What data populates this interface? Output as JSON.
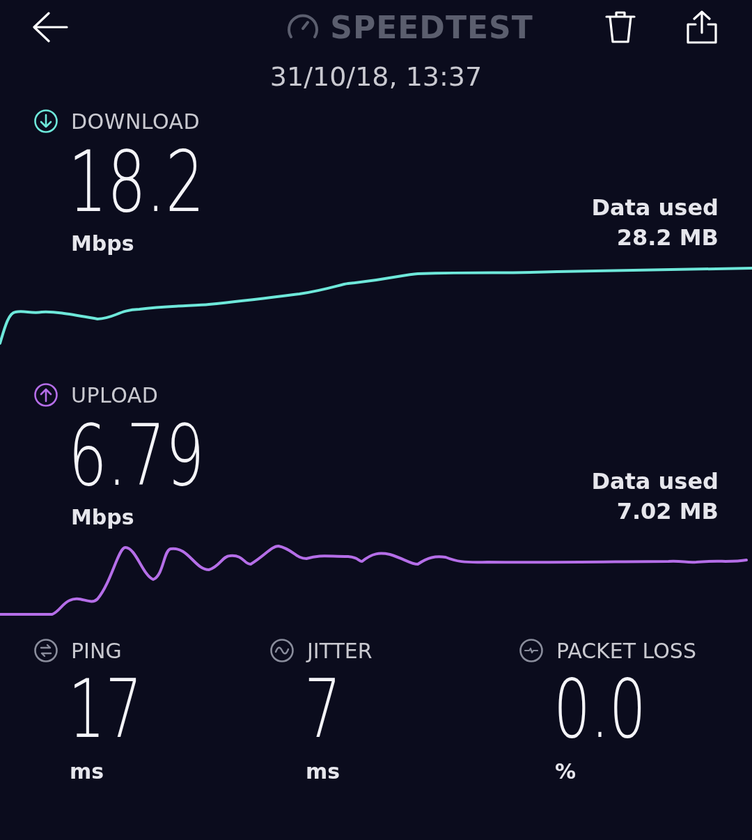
{
  "header": {
    "title": "SPEEDTEST",
    "date": "31/10/18, 13:37"
  },
  "results": [
    {
      "kind": "download",
      "label": "DOWNLOAD",
      "value": "18.2",
      "unit": "Mbps",
      "data_label": "Data used",
      "data_value": "28.2 MB",
      "color": "#6ee8da"
    },
    {
      "kind": "upload",
      "label": "UPLOAD",
      "value": "6.79",
      "unit": "Mbps",
      "data_label": "Data used",
      "data_value": "7.02 MB",
      "color": "#b56ee8"
    }
  ],
  "metrics": [
    {
      "kind": "ping",
      "label": "PING",
      "value": "17",
      "unit": "ms"
    },
    {
      "kind": "jitter",
      "label": "JITTER",
      "value": "7",
      "unit": "ms"
    },
    {
      "kind": "packet_loss",
      "label": "PACKET LOSS",
      "value": "0.0",
      "unit": "%"
    }
  ]
}
